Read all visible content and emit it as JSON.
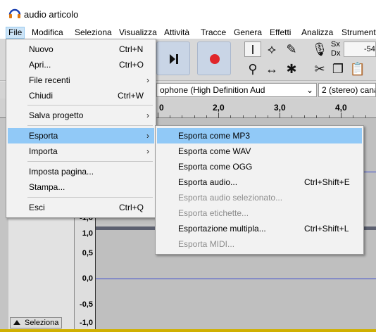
{
  "window": {
    "title": "audio articolo",
    "icon": "headphones-icon"
  },
  "menubar": [
    "File",
    "Modifica",
    "Seleziona",
    "Visualizza",
    "Attività",
    "Tracce",
    "Genera",
    "Effetti",
    "Analizza",
    "Strumenti"
  ],
  "device": {
    "mic_source": "ophone (High Definition Aud",
    "channels": "2 (stereo) canal"
  },
  "meter": {
    "sx": "Sx",
    "dx": "Dx",
    "level": "-54"
  },
  "ruler": {
    "labels": [
      "0",
      "2,0",
      "3,0",
      "4,0"
    ]
  },
  "scale": {
    "labels": [
      "-1,0",
      "1,0",
      "0,5",
      "0,0",
      "-0,5",
      "-1,0"
    ]
  },
  "track": {
    "select_label": "Seleziona"
  },
  "file_menu": {
    "items": [
      {
        "label": "Nuovo",
        "shortcut": "Ctrl+N"
      },
      {
        "label": "Apri...",
        "shortcut": "Ctrl+O"
      },
      {
        "label": "File recenti",
        "shortcut": ""
      },
      {
        "label": "Chiudi",
        "shortcut": "Ctrl+W"
      },
      {
        "label": "Salva progetto",
        "shortcut": ""
      },
      {
        "label": "Esporta",
        "shortcut": ""
      },
      {
        "label": "Importa",
        "shortcut": ""
      },
      {
        "label": "Imposta pagina...",
        "shortcut": ""
      },
      {
        "label": "Stampa...",
        "shortcut": ""
      },
      {
        "label": "Esci",
        "shortcut": "Ctrl+Q"
      }
    ]
  },
  "export_menu": {
    "items": [
      {
        "label": "Esporta come MP3",
        "shortcut": ""
      },
      {
        "label": "Esporta come WAV",
        "shortcut": ""
      },
      {
        "label": "Esporta come OGG",
        "shortcut": ""
      },
      {
        "label": "Esporta audio...",
        "shortcut": "Ctrl+Shift+E"
      },
      {
        "label": "Esporta audio selezionato...",
        "shortcut": ""
      },
      {
        "label": "Esporta etichette...",
        "shortcut": ""
      },
      {
        "label": "Esportazione multipla...",
        "shortcut": "Ctrl+Shift+L"
      },
      {
        "label": "Esporta MIDI...",
        "shortcut": ""
      }
    ]
  },
  "colors": {
    "highlight": "#91c9f7",
    "record": "#e0262b",
    "waveform_line": "#3a4bd0"
  }
}
